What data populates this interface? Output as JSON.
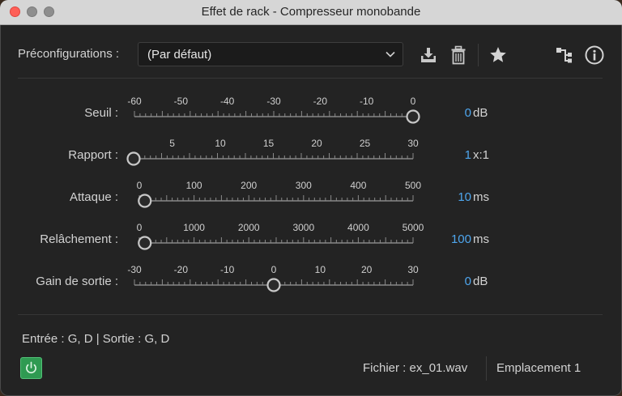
{
  "window": {
    "title": "Effet de rack - Compresseur monobande"
  },
  "presets": {
    "label": "Préconfigurations :",
    "value": "(Par défaut)"
  },
  "icons": [
    "download-icon",
    "trash-icon",
    "star-icon",
    "routing-icon",
    "info-icon",
    "chevron-down-icon",
    "power-icon"
  ],
  "params": [
    {
      "label": "Seuil :",
      "ticks": [
        "-60",
        "-50",
        "-40",
        "-30",
        "-20",
        "-10",
        "0"
      ],
      "min": -60,
      "max": 0,
      "value": 0,
      "display": "0",
      "unit": "dB"
    },
    {
      "label": "Rapport :",
      "ticks": [
        "5",
        "10",
        "15",
        "20",
        "25",
        "30"
      ],
      "tick_values": [
        5,
        10,
        15,
        20,
        25,
        30
      ],
      "min": 1,
      "max": 30,
      "value": 1,
      "display": "1",
      "unit": "x:1"
    },
    {
      "label": "Attaque :",
      "ticks": [
        "0",
        "100",
        "200",
        "300",
        "400",
        "500"
      ],
      "min": 0,
      "max": 500,
      "value": 10,
      "display": "10",
      "unit": "ms"
    },
    {
      "label": "Relâchement :",
      "ticks": [
        "0",
        "1000",
        "2000",
        "3000",
        "4000",
        "5000"
      ],
      "min": 0,
      "max": 5000,
      "value": 100,
      "display": "100",
      "unit": "ms"
    },
    {
      "label": "Gain de sortie :",
      "ticks": [
        "-30",
        "-20",
        "-10",
        "0",
        "10",
        "20",
        "30"
      ],
      "min": -30,
      "max": 30,
      "value": 0,
      "display": "0",
      "unit": "dB"
    }
  ],
  "footer": {
    "io": "Entrée : G, D | Sortie : G, D",
    "file": "Fichier : ex_01.wav",
    "slot": "Emplacement 1"
  },
  "colors": {
    "accent": "#4ea6ee",
    "power": "#2f9a52",
    "background": "#232323"
  }
}
